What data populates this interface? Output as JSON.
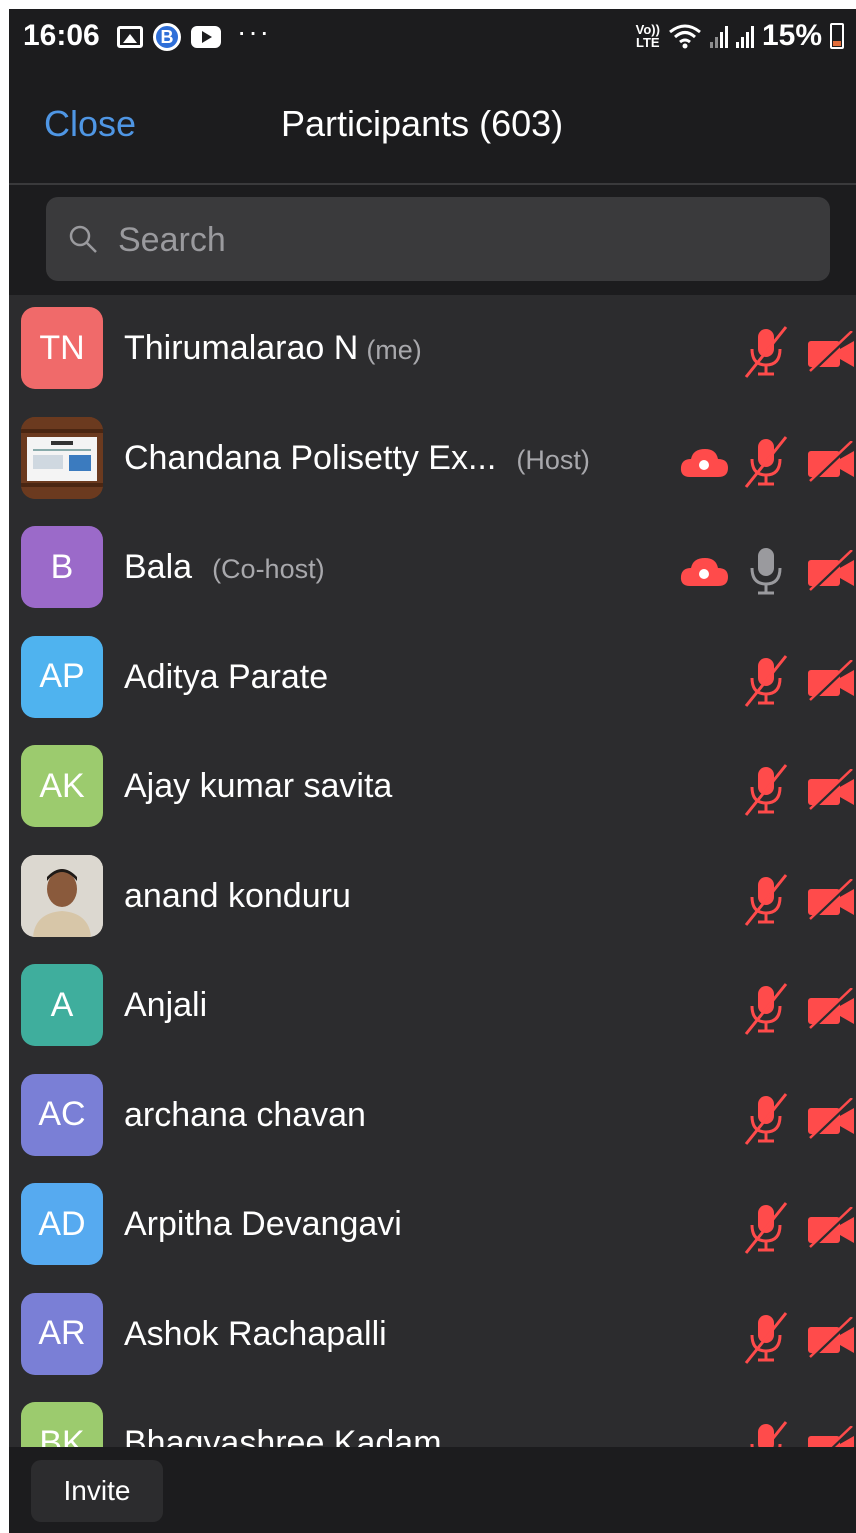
{
  "status_bar": {
    "time": "16:06",
    "volte": "Vo))\nLTE",
    "battery": "15%"
  },
  "header": {
    "close_label": "Close",
    "title": "Participants (603)"
  },
  "search": {
    "placeholder": "Search"
  },
  "colors": {
    "accent_blue": "#4f96e4",
    "muted_red": "#ff4b4b",
    "background": "#1c1c1e",
    "list_background": "#2c2c2e"
  },
  "participants": [
    {
      "initials": "TN",
      "name": "Thirumalarao N",
      "tag": "(me)",
      "avatar_color": "#f06a6a",
      "recording": false,
      "mic": "muted",
      "video": "off"
    },
    {
      "initials": "",
      "name": "Chandana Polisetty Ex...",
      "tag": "(Host)",
      "avatar_color": "#6b3a1f",
      "avatar_image": "presentation-thumbnail",
      "recording": true,
      "mic": "muted",
      "video": "off"
    },
    {
      "initials": "B",
      "name": "Bala",
      "tag": "(Co-host)",
      "avatar_color": "#9b6ac9",
      "recording": true,
      "mic": "unmuted",
      "video": "off"
    },
    {
      "initials": "AP",
      "name": "Aditya Parate",
      "tag": "",
      "avatar_color": "#4fb3ef",
      "recording": false,
      "mic": "muted",
      "video": "off"
    },
    {
      "initials": "AK",
      "name": "Ajay kumar savita",
      "tag": "",
      "avatar_color": "#9ccb6e",
      "recording": false,
      "mic": "muted",
      "video": "off"
    },
    {
      "initials": "",
      "name": "anand konduru",
      "tag": "",
      "avatar_color": "#d9d4cc",
      "avatar_image": "profile-photo",
      "recording": false,
      "mic": "muted",
      "video": "off"
    },
    {
      "initials": "A",
      "name": "Anjali",
      "tag": "",
      "avatar_color": "#3fae9d",
      "recording": false,
      "mic": "muted",
      "video": "off"
    },
    {
      "initials": "AC",
      "name": "archana chavan",
      "tag": "",
      "avatar_color": "#7a7fd6",
      "recording": false,
      "mic": "muted",
      "video": "off"
    },
    {
      "initials": "AD",
      "name": "Arpitha Devangavi",
      "tag": "",
      "avatar_color": "#56aaf0",
      "recording": false,
      "mic": "muted",
      "video": "off"
    },
    {
      "initials": "AR",
      "name": "Ashok Rachapalli",
      "tag": "",
      "avatar_color": "#7a7fd6",
      "recording": false,
      "mic": "muted",
      "video": "off"
    },
    {
      "initials": "BK",
      "name": "Bhagyashree Kadam",
      "tag": "",
      "avatar_color": "#9ccb6e",
      "recording": false,
      "mic": "muted",
      "video": "off"
    }
  ],
  "footer": {
    "invite_label": "Invite"
  }
}
